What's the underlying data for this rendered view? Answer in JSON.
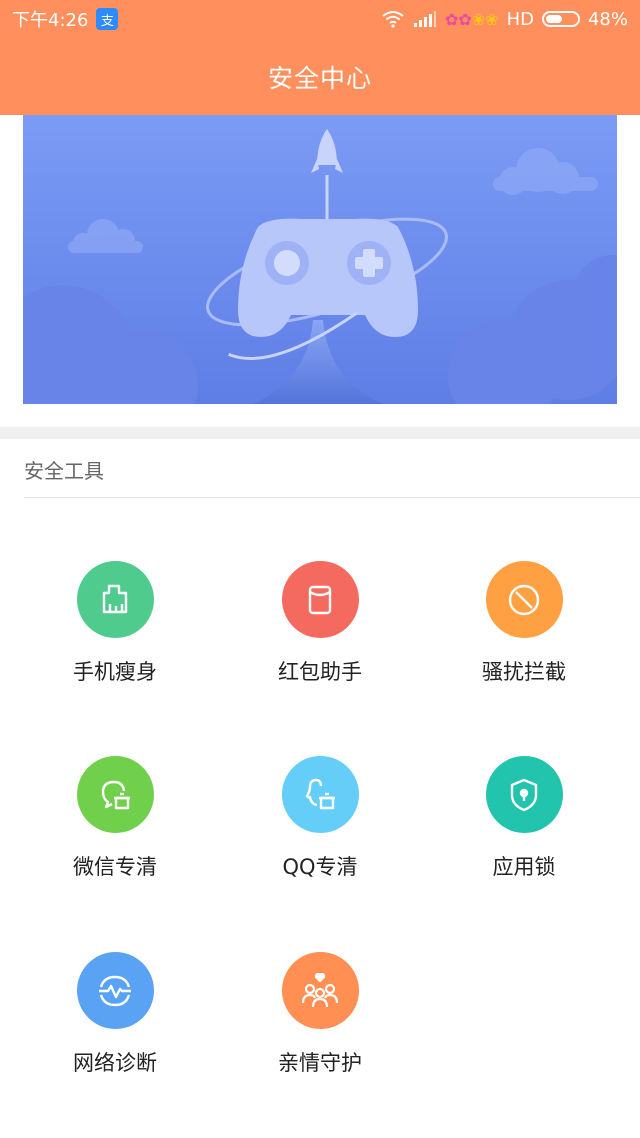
{
  "status_bar": {
    "time": "下午4:26",
    "notification_icon_text": "支",
    "network": "HD",
    "battery": "48%",
    "battery_level": 0.48
  },
  "header": {
    "title": "安全中心",
    "background_color": "#ff8f5c"
  },
  "banner": {
    "illustration": "game-controller-rocket",
    "background_color": "#6f8ff0"
  },
  "section": {
    "title": "安全工具"
  },
  "tools": [
    {
      "label": "手机瘦身",
      "icon": "phone-clean-icon",
      "color": "#4fcb8d"
    },
    {
      "label": "红包助手",
      "icon": "red-packet-icon",
      "color": "#f46a5f"
    },
    {
      "label": "骚扰拦截",
      "icon": "block-icon",
      "color": "#ffa142"
    },
    {
      "label": "微信专清",
      "icon": "wechat-clean-icon",
      "color": "#70d04c"
    },
    {
      "label": "QQ专清",
      "icon": "qq-clean-icon",
      "color": "#64cdf8"
    },
    {
      "label": "应用锁",
      "icon": "app-lock-icon",
      "color": "#22c4ad"
    },
    {
      "label": "网络诊断",
      "icon": "network-diagnosis-icon",
      "color": "#5aa2f3"
    },
    {
      "label": "亲情守护",
      "icon": "family-guard-icon",
      "color": "#ff8f52"
    }
  ]
}
